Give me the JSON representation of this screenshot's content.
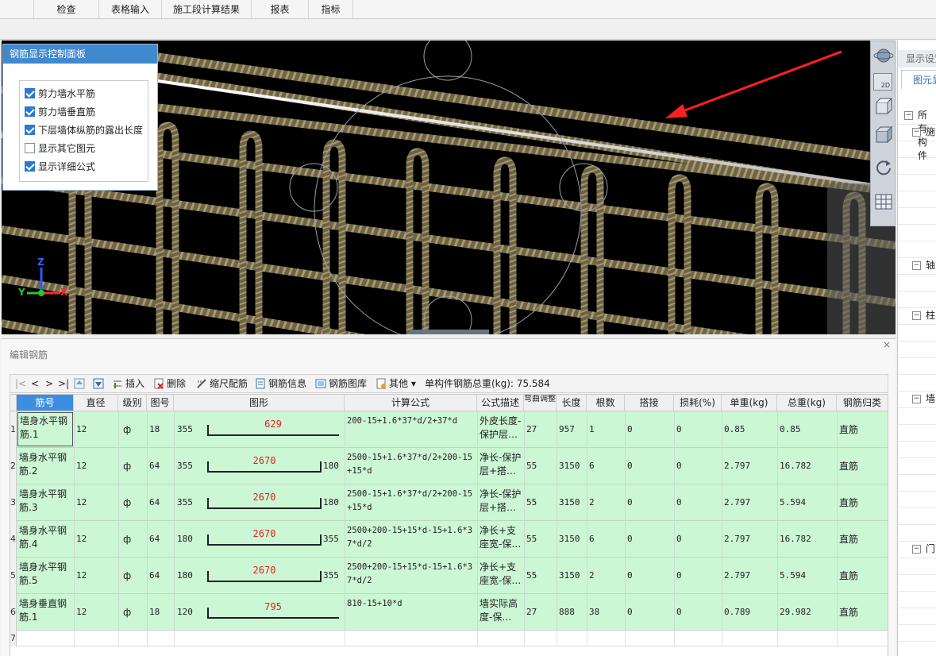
{
  "top_tabs": [
    "检查",
    "表格输入",
    "施工段计算结果",
    "报表",
    "指标"
  ],
  "control_panel": {
    "title": "钢筋显示控制面板",
    "options": [
      {
        "label": "剪力墙水平筋",
        "checked": true
      },
      {
        "label": "剪力墙垂直筋",
        "checked": true
      },
      {
        "label": "下层墙体纵筋的露出长度",
        "checked": true
      },
      {
        "label": "显示其它图元",
        "checked": false
      },
      {
        "label": "显示详细公式",
        "checked": true
      }
    ]
  },
  "axis": {
    "z": "Z",
    "y": "Y",
    "x": "X"
  },
  "right_toolbar": {
    "mode_label": "2D"
  },
  "right_panel": {
    "header": "显示设置",
    "tab": "图元显示",
    "tree": [
      {
        "sign": "⊟",
        "text": "所有构件",
        "level": 0
      },
      {
        "sign": "⊟",
        "text": "施",
        "level": 1
      },
      {
        "sign": "⊟",
        "text": "轴",
        "level": 1
      },
      {
        "sign": "⊟",
        "text": "柱",
        "level": 1
      },
      {
        "sign": "⊟",
        "text": "墙",
        "level": 1
      },
      {
        "sign": "⊟",
        "text": "门",
        "level": 1
      }
    ]
  },
  "edit_panel": {
    "title": "编辑钢筋",
    "close": "×",
    "toolbar": {
      "insert": "插入",
      "delete": "删除",
      "scale": "缩尺配筋",
      "info": "钢筋信息",
      "library": "钢筋图库",
      "other": "其他",
      "total_label": "单构件钢筋总重(kg):",
      "total_value": "75.584"
    },
    "columns": [
      "筋号",
      "直径(mm)",
      "级别",
      "图号",
      "图形",
      "计算公式",
      "公式描述",
      "弯曲调整",
      "长度",
      "根数",
      "搭接",
      "损耗(%)",
      "单重(kg)",
      "总重(kg)",
      "钢筋归类"
    ],
    "rows": [
      {
        "num": "1",
        "name": "墙身水平钢筋.1",
        "dia": "12",
        "grade": "ф",
        "fig_no": "18",
        "left": "355",
        "mid": "629",
        "right": "",
        "formula": "200-15+1.6*37*d/2+37*d",
        "desc": "外皮长度-保护层…",
        "bend": "27",
        "length": "957",
        "count": "1",
        "lap": "0",
        "loss": "0",
        "unit_w": "0.85",
        "total_w": "0.85",
        "type": "直筋"
      },
      {
        "num": "2",
        "name": "墙身水平钢筋.2",
        "dia": "12",
        "grade": "ф",
        "fig_no": "64",
        "left": "355",
        "mid": "2670",
        "right": "180",
        "formula": "2500-15+1.6*37*d/2+200-15+15*d",
        "desc": "净长-保护层+搭…",
        "bend": "55",
        "length": "3150",
        "count": "6",
        "lap": "0",
        "loss": "0",
        "unit_w": "2.797",
        "total_w": "16.782",
        "type": "直筋"
      },
      {
        "num": "3",
        "name": "墙身水平钢筋.3",
        "dia": "12",
        "grade": "ф",
        "fig_no": "64",
        "left": "355",
        "mid": "2670",
        "right": "180",
        "formula": "2500-15+1.6*37*d/2+200-15+15*d",
        "desc": "净长-保护层+搭…",
        "bend": "55",
        "length": "3150",
        "count": "2",
        "lap": "0",
        "loss": "0",
        "unit_w": "2.797",
        "total_w": "5.594",
        "type": "直筋"
      },
      {
        "num": "4",
        "name": "墙身水平钢筋.4",
        "dia": "12",
        "grade": "ф",
        "fig_no": "64",
        "left": "180",
        "mid": "2670",
        "right": "355",
        "formula": "2500+200-15+15*d-15+1.6*37*d/2",
        "desc": "净长+支座宽-保…",
        "bend": "55",
        "length": "3150",
        "count": "6",
        "lap": "0",
        "loss": "0",
        "unit_w": "2.797",
        "total_w": "16.782",
        "type": "直筋"
      },
      {
        "num": "5",
        "name": "墙身水平钢筋.5",
        "dia": "12",
        "grade": "ф",
        "fig_no": "64",
        "left": "180",
        "mid": "2670",
        "right": "355",
        "formula": "2500+200-15+15*d-15+1.6*37*d/2",
        "desc": "净长+支座宽-保…",
        "bend": "55",
        "length": "3150",
        "count": "2",
        "lap": "0",
        "loss": "0",
        "unit_w": "2.797",
        "total_w": "5.594",
        "type": "直筋"
      },
      {
        "num": "6",
        "name": "墙身垂直钢筋.1",
        "dia": "12",
        "grade": "ф",
        "fig_no": "18",
        "left": "120",
        "mid": "795",
        "right": "",
        "formula": "810-15+10*d",
        "desc": "墙实际高度-保…",
        "bend": "27",
        "length": "888",
        "count": "38",
        "lap": "0",
        "loss": "0",
        "unit_w": "0.789",
        "total_w": "29.982",
        "type": "直筋"
      }
    ],
    "empty_row": "7"
  },
  "colors": {
    "accent": "#3f89cf",
    "row_green": "#ccf7d4",
    "figure_red": "#e02020",
    "arrow_red": "#ff2020"
  }
}
